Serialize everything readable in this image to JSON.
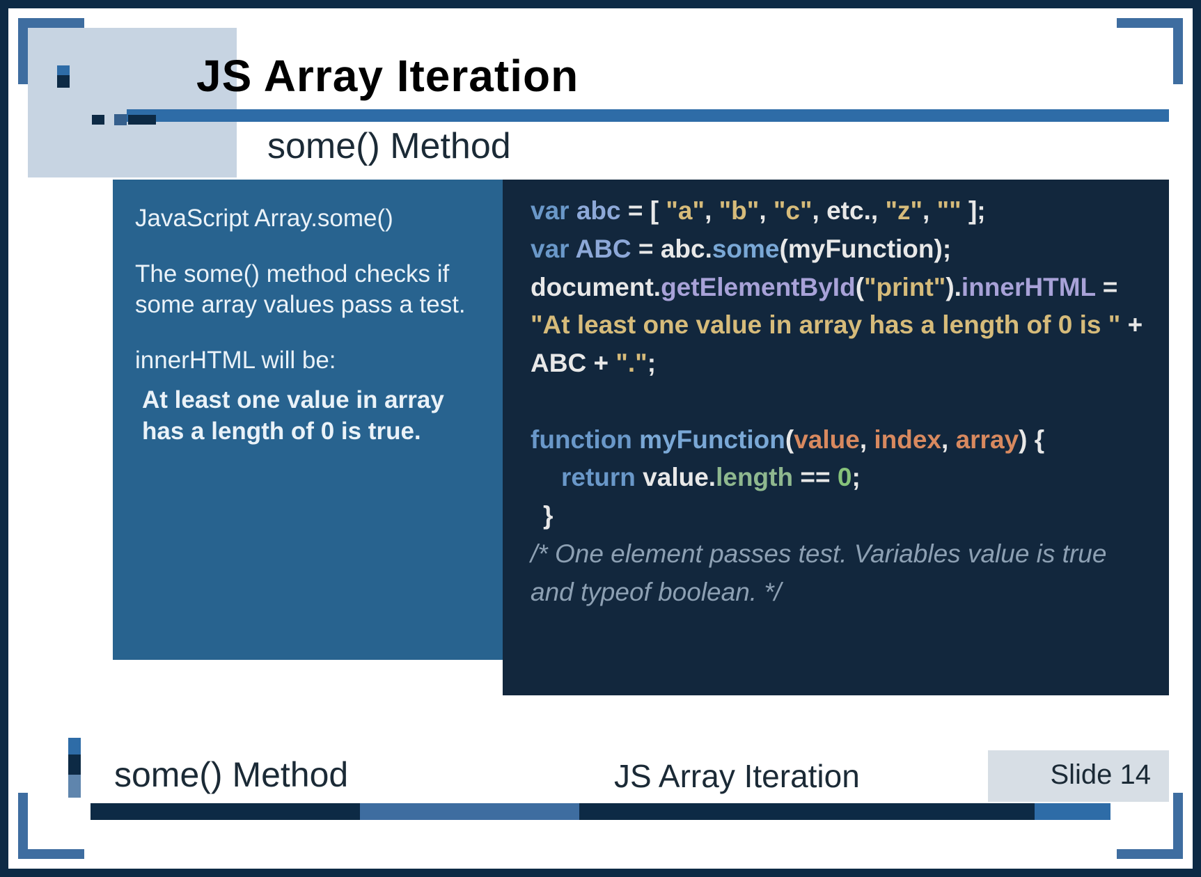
{
  "header": {
    "title": "JS Array Iteration",
    "subtitle": "some() Method"
  },
  "left": {
    "heading": "JavaScript Array.some()",
    "desc": "The some() method checks if some array values pass a test.",
    "label": "innerHTML will be:",
    "output": "At least one value in array has a length of 0 is true."
  },
  "code": {
    "l1": {
      "kw": "var",
      "name": "abc",
      "eq": " = [ ",
      "s1": "\"a\"",
      "c1": ", ",
      "s2": "\"b\"",
      "c2": ", ",
      "s3": "\"c\"",
      "c3": ", etc., ",
      "s4": "\"z\"",
      "c4": ", ",
      "s5": "\"\"",
      "end": " ];"
    },
    "l2": {
      "kw": "var",
      "name": "ABC",
      "eq": " = abc.",
      "fn": "some",
      "open": "(",
      "arg": "myFunction",
      "close": ");"
    },
    "l3": {
      "obj": "document.",
      "fn": "getElementById",
      "open": "(",
      "str": "\"print\"",
      "close": ").",
      "prop": "innerHTML",
      "eq": " ="
    },
    "l4": {
      "str": "\"At least one value in array has a length of 0 is \"",
      "plus": " +"
    },
    "l5": {
      "pre": " ABC + ",
      "str": "\".\"",
      "semi": ";"
    },
    "l6": {
      "kw": "function",
      "name": " myFunction",
      "open": "(",
      "a1": "value",
      "c1": ", ",
      "a2": "index",
      "c2": ", ",
      "a3": "array",
      "close": ") {"
    },
    "l7": {
      "kw": "return",
      "txt": " value.",
      "prop": "length",
      "eq": " == ",
      "num": "0",
      "semi": ";"
    },
    "l8": "}",
    "comment": "/* One element passes test. Variables value is true and typeof boolean. */"
  },
  "footer": {
    "subtitle": "some() Method",
    "title": "JS Array Iteration",
    "slide": "Slide 14"
  }
}
